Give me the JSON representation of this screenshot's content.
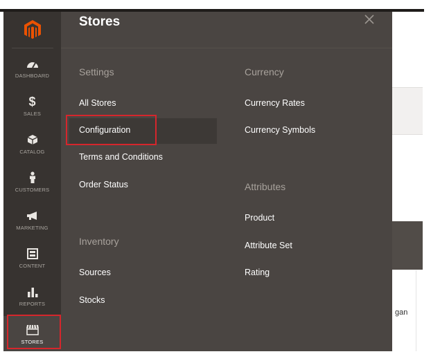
{
  "sidebar": {
    "items": [
      {
        "label": "DASHBOARD",
        "icon": "dashboard-icon"
      },
      {
        "label": "SALES",
        "icon": "dollar-icon"
      },
      {
        "label": "CATALOG",
        "icon": "cube-icon"
      },
      {
        "label": "CUSTOMERS",
        "icon": "person-icon"
      },
      {
        "label": "MARKETING",
        "icon": "megaphone-icon"
      },
      {
        "label": "CONTENT",
        "icon": "layout-icon"
      },
      {
        "label": "REPORTS",
        "icon": "bar-chart-icon"
      },
      {
        "label": "STORES",
        "icon": "storefront-icon",
        "active": true
      }
    ]
  },
  "panel": {
    "title": "Stores",
    "close_icon": "close-icon",
    "settings": {
      "title": "Settings",
      "items": [
        "All Stores",
        "Configuration",
        "Terms and Conditions",
        "Order Status"
      ]
    },
    "inventory": {
      "title": "Inventory",
      "items": [
        "Sources",
        "Stocks"
      ]
    },
    "currency": {
      "title": "Currency",
      "items": [
        "Currency Rates",
        "Currency Symbols"
      ]
    },
    "attributes": {
      "title": "Attributes",
      "items": [
        "Product",
        "Attribute Set",
        "Rating"
      ]
    }
  },
  "background": {
    "partial_text": "gan"
  },
  "colors": {
    "sidebar_bg": "#373330",
    "panel_bg": "#4a4542",
    "brand_orange": "#eb5202",
    "highlight_red": "#d6262c"
  }
}
